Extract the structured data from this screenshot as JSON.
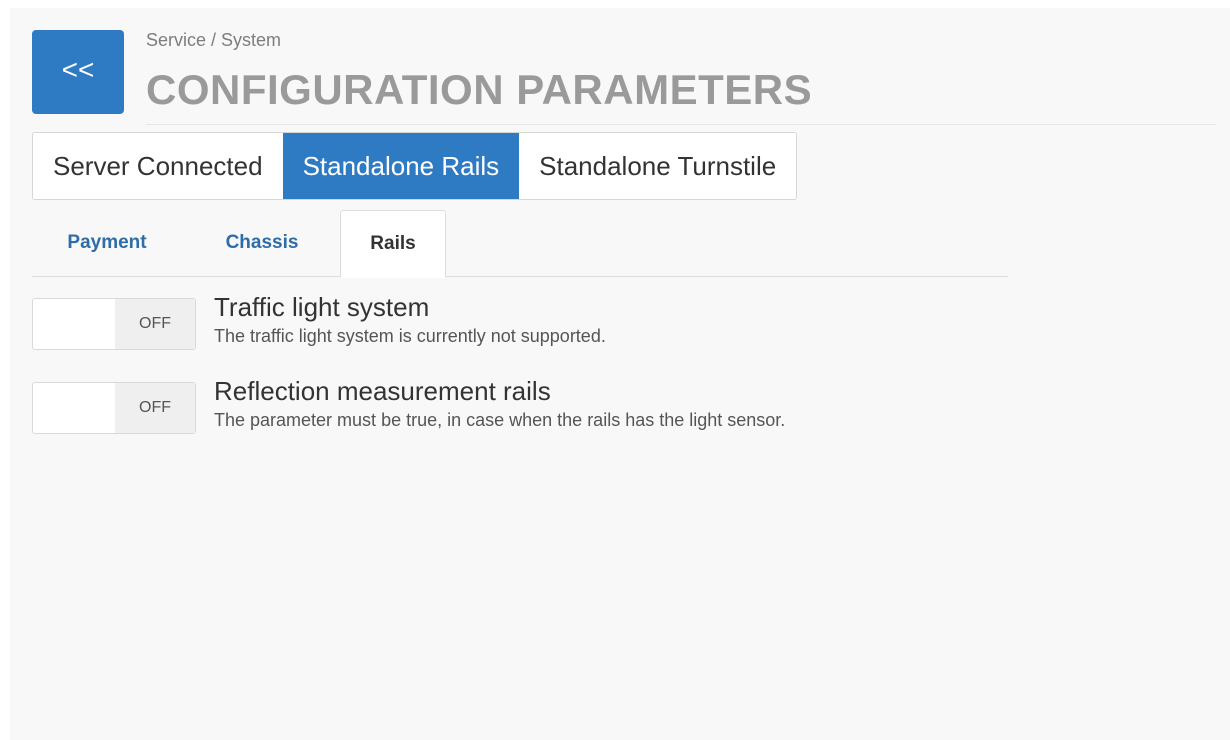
{
  "header": {
    "back_label": "<<",
    "breadcrumb": "Service / System",
    "title": "CONFIGURATION PARAMETERS"
  },
  "mode_tabs": [
    {
      "label": "Server Connected",
      "active": false
    },
    {
      "label": "Standalone Rails",
      "active": true
    },
    {
      "label": "Standalone Turnstile",
      "active": false
    }
  ],
  "sub_tabs": [
    {
      "label": "Payment",
      "active": false
    },
    {
      "label": "Chassis",
      "active": false
    },
    {
      "label": "Rails",
      "active": true
    }
  ],
  "settings": [
    {
      "label": "Traffic light system",
      "description": "The traffic light system is currently not supported.",
      "state_label": "OFF"
    },
    {
      "label": "Reflection measurement rails",
      "description": "The parameter must be true, in case when the rails has the light sensor.",
      "state_label": "OFF"
    }
  ],
  "colors": {
    "accent": "#2e7bc4",
    "link": "#2e6da8",
    "title": "#9a9a9a"
  }
}
